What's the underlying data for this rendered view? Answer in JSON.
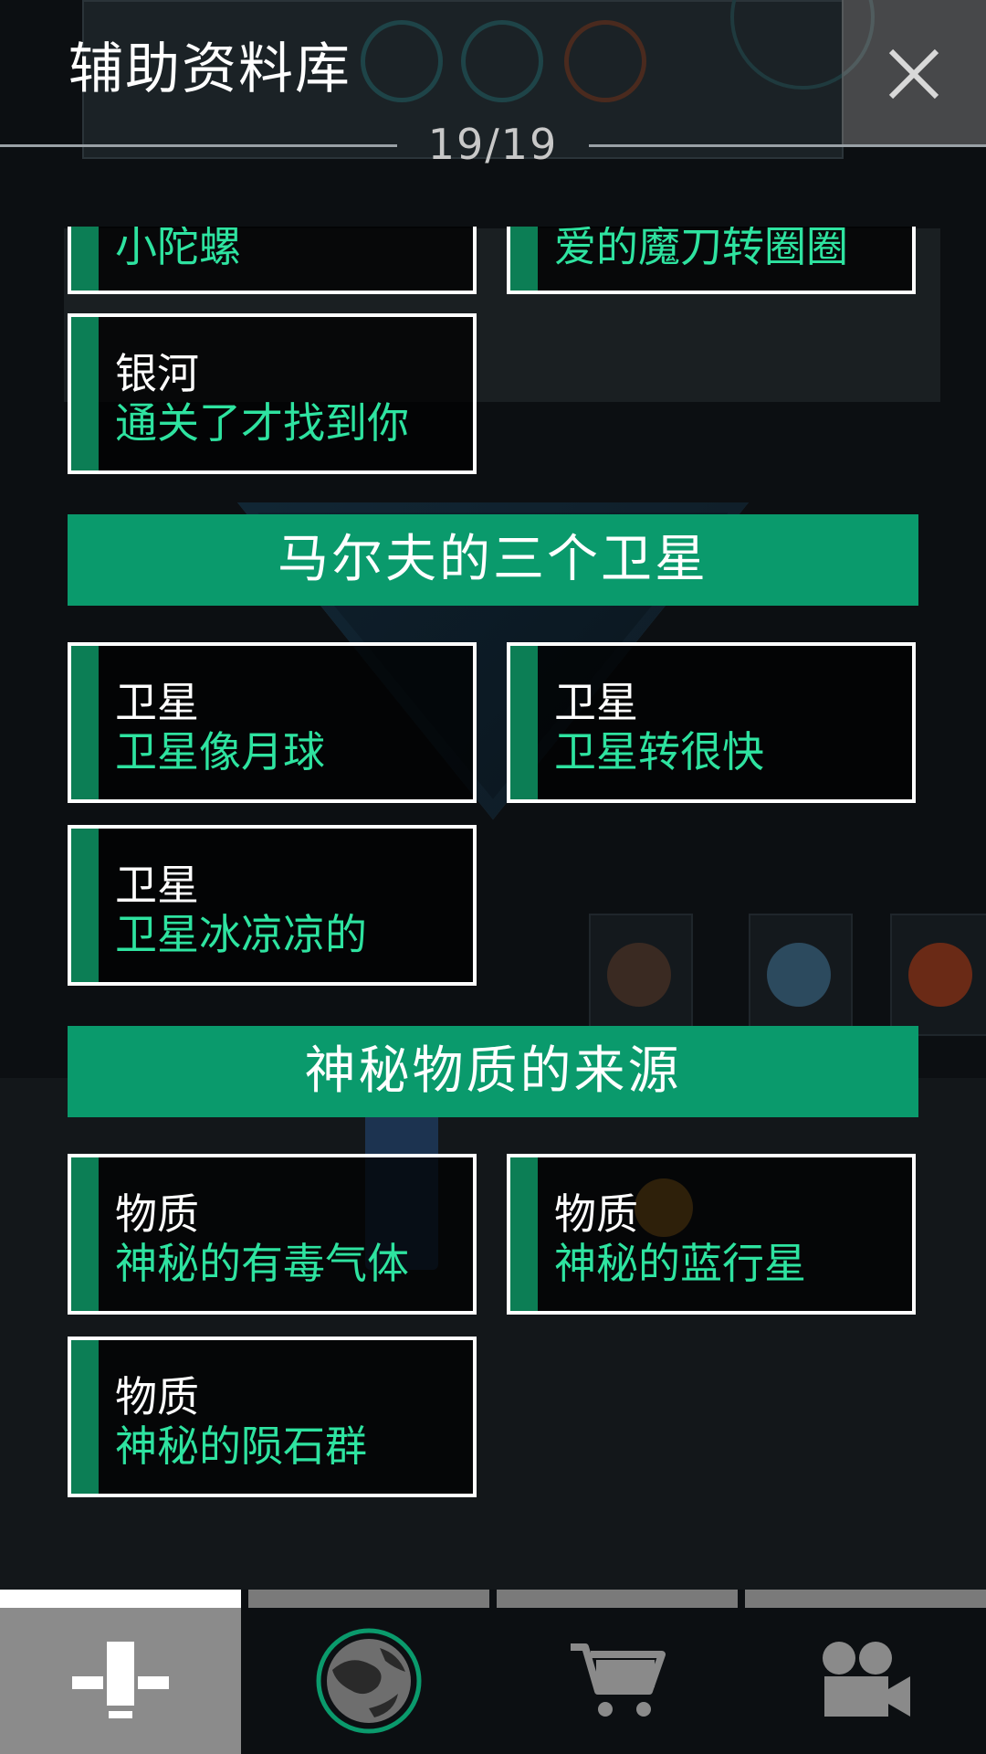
{
  "header": {
    "title": "辅助资料库",
    "counter": "19/19",
    "close_icon": "close-icon"
  },
  "list": {
    "top_cards": [
      {
        "category": "",
        "name": "小陀螺"
      },
      {
        "category": "",
        "name": "爱的魔刀转圈圈"
      }
    ],
    "galaxy_card": {
      "category": "银河",
      "name": "通关了才找到你"
    },
    "sections": [
      {
        "title": "马尔夫的三个卫星",
        "cards": [
          {
            "category": "卫星",
            "name": "卫星像月球"
          },
          {
            "category": "卫星",
            "name": "卫星转很快"
          },
          {
            "category": "卫星",
            "name": "卫星冰凉凉的"
          }
        ]
      },
      {
        "title": "神秘物质的来源",
        "cards": [
          {
            "category": "物质",
            "name": "神秘的有毒气体"
          },
          {
            "category": "物质",
            "name": "神秘的蓝行星"
          },
          {
            "category": "物质",
            "name": "神秘的陨石群"
          }
        ]
      }
    ]
  },
  "nav": {
    "tabs": [
      {
        "icon": "data-library-icon",
        "active": true
      },
      {
        "icon": "planet-icon",
        "active": false
      },
      {
        "icon": "cart-icon",
        "active": false
      },
      {
        "icon": "video-camera-icon",
        "active": false
      }
    ]
  },
  "colors": {
    "accent": "#0a9a6c",
    "card_name_text": "#2ee3a0",
    "card_border": "#ffffff"
  }
}
